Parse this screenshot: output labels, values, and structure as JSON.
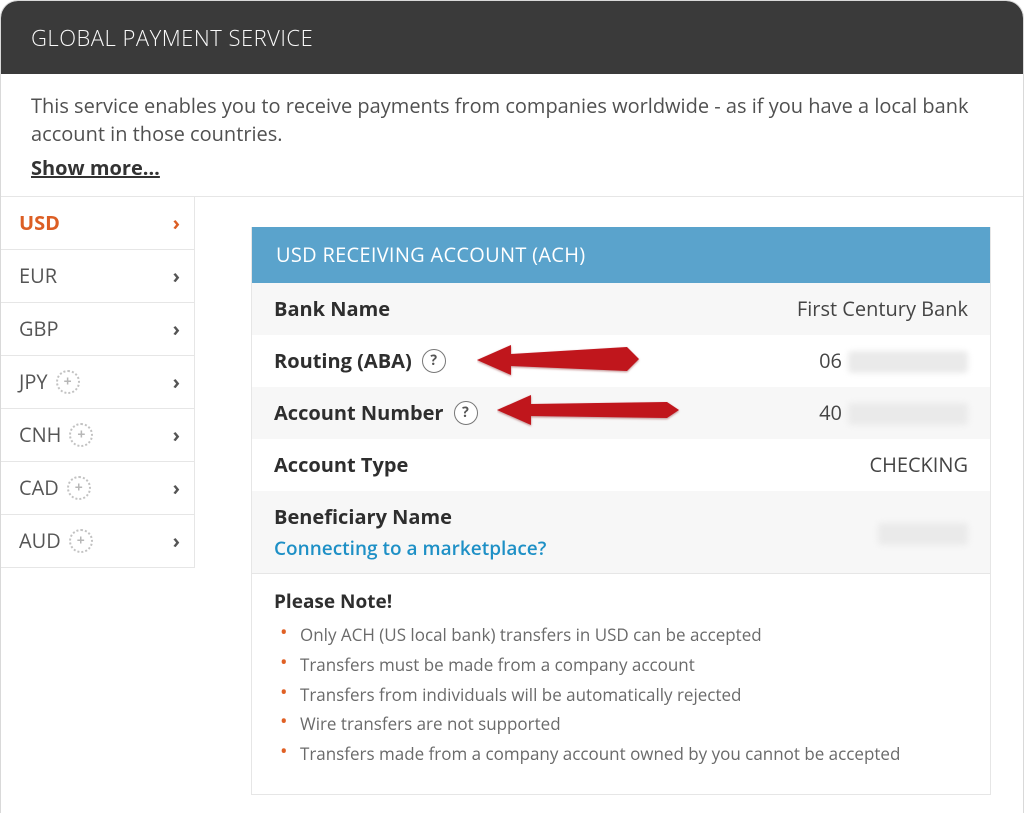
{
  "header": {
    "title": "GLOBAL PAYMENT SERVICE"
  },
  "intro": {
    "text": "This service enables you to receive payments from companies worldwide - as if you have a local bank account in those countries.",
    "showmore": "Show more..."
  },
  "sidebar": {
    "currencies": [
      {
        "code": "USD",
        "has_plus": false,
        "active": true
      },
      {
        "code": "EUR",
        "has_plus": false,
        "active": false
      },
      {
        "code": "GBP",
        "has_plus": false,
        "active": false
      },
      {
        "code": "JPY",
        "has_plus": true,
        "active": false
      },
      {
        "code": "CNH",
        "has_plus": true,
        "active": false
      },
      {
        "code": "CAD",
        "has_plus": true,
        "active": false
      },
      {
        "code": "AUD",
        "has_plus": true,
        "active": false
      }
    ]
  },
  "panel": {
    "title": "USD RECEIVING ACCOUNT (ACH)",
    "bank_name_label": "Bank Name",
    "bank_name_value": "First Century Bank",
    "routing_label": "Routing (ABA)",
    "routing_prefix": "06",
    "account_number_label": "Account Number",
    "account_number_prefix": "40",
    "account_type_label": "Account Type",
    "account_type_value": "CHECKING",
    "beneficiary_label": "Beneficiary Name",
    "beneficiary_link": "Connecting to a marketplace?",
    "help_glyph": "?"
  },
  "note": {
    "heading": "Please Note!",
    "items": [
      "Only ACH (US local bank) transfers in USD can be accepted",
      "Transfers must be made from a company account",
      "Transfers from individuals will be automatically rejected",
      "Wire transfers are not supported",
      "Transfers made from a company account owned by you cannot be accepted"
    ]
  },
  "icons": {
    "chev_right": "›",
    "plus": "+"
  },
  "colors": {
    "orange": "#dc5e24",
    "panel_head": "#5aa3cc",
    "header_bg": "#3a3a3a",
    "link": "#1e90c6",
    "arrow": "#c0131f"
  }
}
